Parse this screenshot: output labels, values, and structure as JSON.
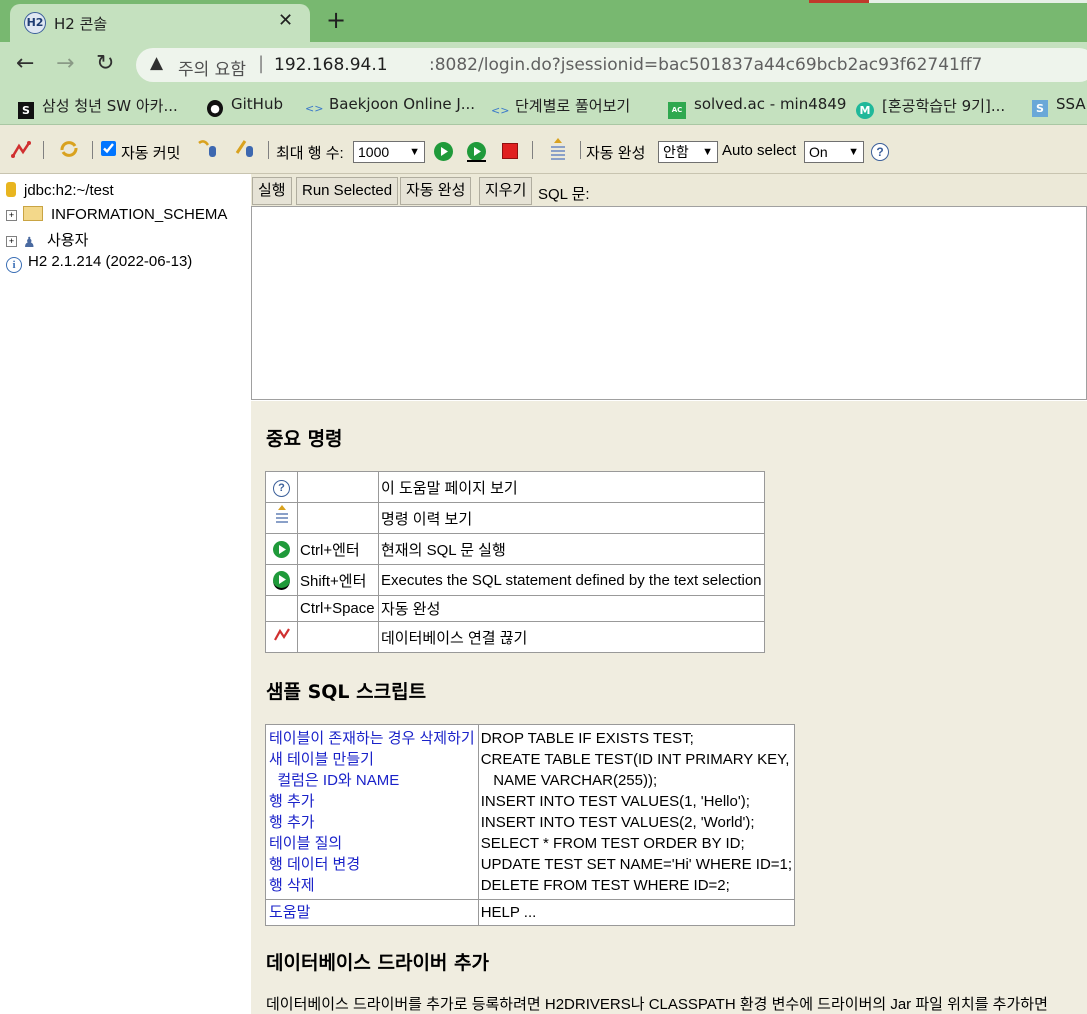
{
  "browser": {
    "tab_title": "H2 콘솔",
    "tab_favicon": "H2",
    "close_glyph": "✕",
    "new_tab_glyph": "+",
    "security_warning": "주의 요함",
    "separator": "|",
    "url_host": "192.168.94.1",
    "url_path": ":8082/login.do?jsessionid=bac501837a44c69bcb2ac93f62741ff7",
    "bookmarks": [
      {
        "label": "삼성 청년 SW 아카...",
        "icon": "samsung-icon"
      },
      {
        "label": "GitHub",
        "icon": "github-icon"
      },
      {
        "label": "Baekjoon Online J...",
        "icon": "code-icon"
      },
      {
        "label": "단계별로 풀어보기",
        "icon": "code-icon"
      },
      {
        "label": "solved.ac - min4849",
        "icon": "solvedac-icon"
      },
      {
        "label": "[혼공학습단 9기]...",
        "icon": "hongong-icon"
      },
      {
        "label": "SSA",
        "icon": "samsung-icon"
      }
    ]
  },
  "toolbar": {
    "autocommit_label": "자동 커밋",
    "autocommit_checked": true,
    "max_rows_label": "최대 행 수:",
    "max_rows_value": "1000",
    "autocomplete_label": "자동 완성",
    "autocomplete_value": "안함",
    "autoselect_label": "Auto select",
    "autoselect_value": "On",
    "help_glyph": "?"
  },
  "tree": {
    "connection": "jdbc:h2:~/test",
    "items": [
      "INFORMATION_SCHEMA",
      "사용자"
    ],
    "version": "H2 2.1.214 (2022-06-13)"
  },
  "sql": {
    "buttons": [
      "실행",
      "Run Selected",
      "자동 완성",
      "지우기"
    ],
    "label": "SQL 문:"
  },
  "help": {
    "important_title": "중요 명령",
    "commands": [
      {
        "icon": "help-icon",
        "key": "",
        "desc": "이 도움말 페이지 보기"
      },
      {
        "icon": "history-icon",
        "key": "",
        "desc": "명령 이력 보기"
      },
      {
        "icon": "run-icon",
        "key": "Ctrl+엔터",
        "desc": "현재의 SQL 문 실행"
      },
      {
        "icon": "run-selected-icon",
        "key": "Shift+엔터",
        "desc": "Executes the SQL statement defined by the text selection"
      },
      {
        "icon": "",
        "key": "Ctrl+Space",
        "desc": "자동 완성"
      },
      {
        "icon": "disconnect-icon",
        "key": "",
        "desc": "데이터베이스 연결 끊기"
      }
    ],
    "sample_title": "샘플 SQL 스크립트",
    "sample_links": [
      "테이블이 존재하는 경우 삭제하기",
      "새 테이블 만들기",
      "  컬럼은 ID와 NAME",
      "행 추가",
      "행 추가",
      "테이블 질의",
      "행 데이터 변경",
      "행 삭제"
    ],
    "sample_sql": [
      "DROP TABLE IF EXISTS TEST;",
      "CREATE TABLE TEST(ID INT PRIMARY KEY,",
      "   NAME VARCHAR(255));",
      "INSERT INTO TEST VALUES(1, 'Hello');",
      "INSERT INTO TEST VALUES(2, 'World');",
      "SELECT * FROM TEST ORDER BY ID;",
      "UPDATE TEST SET NAME='Hi' WHERE ID=1;",
      "DELETE FROM TEST WHERE ID=2;"
    ],
    "help_link": "도움말",
    "help_sql": "HELP ...",
    "driver_title": "데이터베이스 드라이버 추가",
    "driver_text": "데이터베이스 드라이버를 추가로 등록하려면 H2DRIVERS나 CLASSPATH 환경 변수에 드라이버의 Jar 파일 위치를 추가하면"
  }
}
